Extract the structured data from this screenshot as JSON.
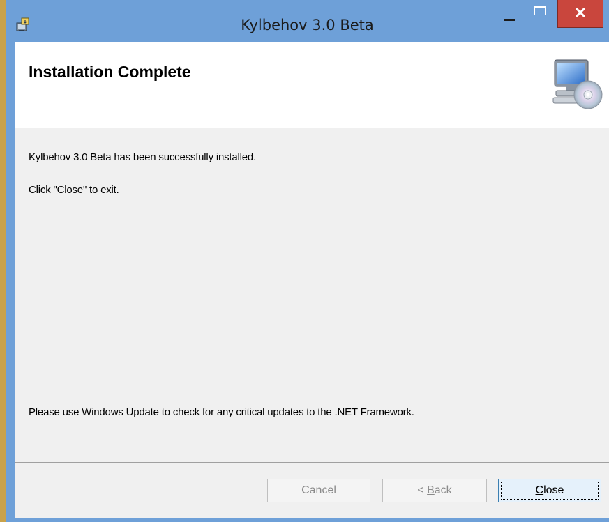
{
  "window": {
    "title": "Kylbehov 3.0 Beta",
    "close_glyph": "✕",
    "app_icon": "installer-icon"
  },
  "header": {
    "title": "Installation Complete",
    "icon": "computer-cd-icon"
  },
  "body": {
    "line1": "Kylbehov 3.0 Beta has been successfully installed.",
    "line2": "Click \"Close\" to exit.",
    "line3": "Please use Windows Update to check for any critical updates to the .NET Framework."
  },
  "buttons": {
    "cancel": "Cancel",
    "back_arrow": "< ",
    "back_mnemonic": "B",
    "back_rest": "ack",
    "close_mnemonic": "C",
    "close_rest": "lose"
  },
  "colors": {
    "titlebar": "#6ea0d8",
    "close_button": "#c9463d",
    "focused_button": "#e5f1fb"
  }
}
